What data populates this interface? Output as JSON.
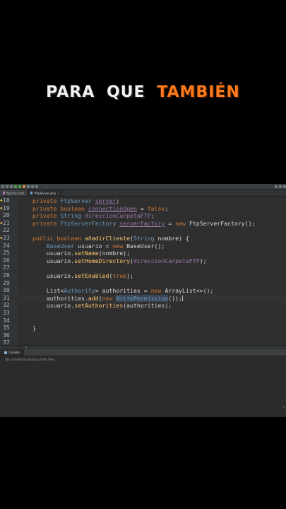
{
  "caption": {
    "words": [
      "PARA",
      "QUE",
      "TAMBIÉN"
    ],
    "colors": [
      "#f2f2f2",
      "#f2f2f2",
      "#ff7a1a"
    ]
  },
  "tabs": [
    {
      "label": "ftpUsers.xml",
      "active": false
    },
    {
      "label": "*FtpServer.java",
      "active": true
    }
  ],
  "lines": [
    {
      "num": "18",
      "marker": true,
      "segs": [
        [
          "k",
          "private "
        ],
        [
          "t",
          "FtpServer "
        ],
        [
          "f u",
          "server"
        ],
        [
          "p",
          ";"
        ]
      ]
    },
    {
      "num": "19",
      "marker": true,
      "segs": [
        [
          "k",
          "private boolean "
        ],
        [
          "f u",
          "connectionOpen"
        ],
        [
          "p",
          " = "
        ],
        [
          "k",
          "false"
        ],
        [
          "p",
          ";"
        ]
      ]
    },
    {
      "num": "20",
      "marker": false,
      "segs": [
        [
          "k",
          "private "
        ],
        [
          "t",
          "String "
        ],
        [
          "f",
          "direccionCarpetaFTP"
        ],
        [
          "p",
          ";"
        ]
      ]
    },
    {
      "num": "21",
      "marker": true,
      "segs": [
        [
          "k",
          "private "
        ],
        [
          "t",
          "FtpServerFactory "
        ],
        [
          "f u",
          "serverFactory"
        ],
        [
          "p",
          " = "
        ],
        [
          "k",
          "new "
        ],
        [
          "p",
          "FtpServerFactory();"
        ]
      ]
    },
    {
      "num": "22",
      "marker": false,
      "segs": []
    },
    {
      "num": "23",
      "marker": true,
      "segs": [
        [
          "k",
          "public boolean "
        ],
        [
          "m",
          "añadirCliente"
        ],
        [
          "p",
          "("
        ],
        [
          "t",
          "String "
        ],
        [
          "p",
          "nombre) {"
        ]
      ]
    },
    {
      "num": "24",
      "marker": false,
      "segs": [
        [
          "t",
          "    BaseUser "
        ],
        [
          "p",
          "usuario = "
        ],
        [
          "k",
          "new "
        ],
        [
          "p",
          "BaseUser();"
        ]
      ]
    },
    {
      "num": "25",
      "marker": false,
      "segs": [
        [
          "p",
          "    usuario."
        ],
        [
          "m",
          "setName"
        ],
        [
          "p",
          "(nombre);"
        ]
      ]
    },
    {
      "num": "26",
      "marker": false,
      "segs": [
        [
          "p",
          "    usuario."
        ],
        [
          "m",
          "setHomeDirectory"
        ],
        [
          "p",
          "("
        ],
        [
          "f",
          "direccionCarpetaFTP"
        ],
        [
          "p",
          ");"
        ]
      ]
    },
    {
      "num": "27",
      "marker": false,
      "segs": []
    },
    {
      "num": "28",
      "marker": false,
      "segs": [
        [
          "p",
          "    usuario."
        ],
        [
          "m",
          "setEnabled"
        ],
        [
          "p",
          "("
        ],
        [
          "k",
          "true"
        ],
        [
          "p",
          ");"
        ]
      ]
    },
    {
      "num": "29",
      "marker": false,
      "segs": []
    },
    {
      "num": "30",
      "marker": false,
      "segs": [
        [
          "p",
          "    List<"
        ],
        [
          "t",
          "Authority"
        ],
        [
          "p",
          "> authorities = "
        ],
        [
          "k",
          "new "
        ],
        [
          "p",
          "ArrayList<>();"
        ]
      ]
    },
    {
      "num": "31",
      "marker": false,
      "segs": [
        [
          "p",
          "    authorities."
        ],
        [
          "m",
          "add"
        ],
        [
          "p",
          "("
        ],
        [
          "k",
          "new "
        ],
        [
          "hl",
          "WritePermission"
        ],
        [
          "p",
          "());"
        ]
      ]
    },
    {
      "num": "32",
      "marker": false,
      "segs": [
        [
          "p",
          "    usuario."
        ],
        [
          "m",
          "setAuthorities"
        ],
        [
          "p",
          "(authorities);"
        ]
      ]
    },
    {
      "num": "33",
      "marker": false,
      "segs": []
    },
    {
      "num": "34",
      "marker": false,
      "segs": []
    },
    {
      "num": "35",
      "marker": false,
      "segs": [
        [
          "p",
          "}"
        ]
      ]
    },
    {
      "num": "36",
      "marker": false,
      "segs": []
    },
    {
      "num": "37",
      "marker": false,
      "segs": []
    }
  ],
  "console": {
    "tab_label": "Console",
    "message": "No consoles to display at this time."
  }
}
